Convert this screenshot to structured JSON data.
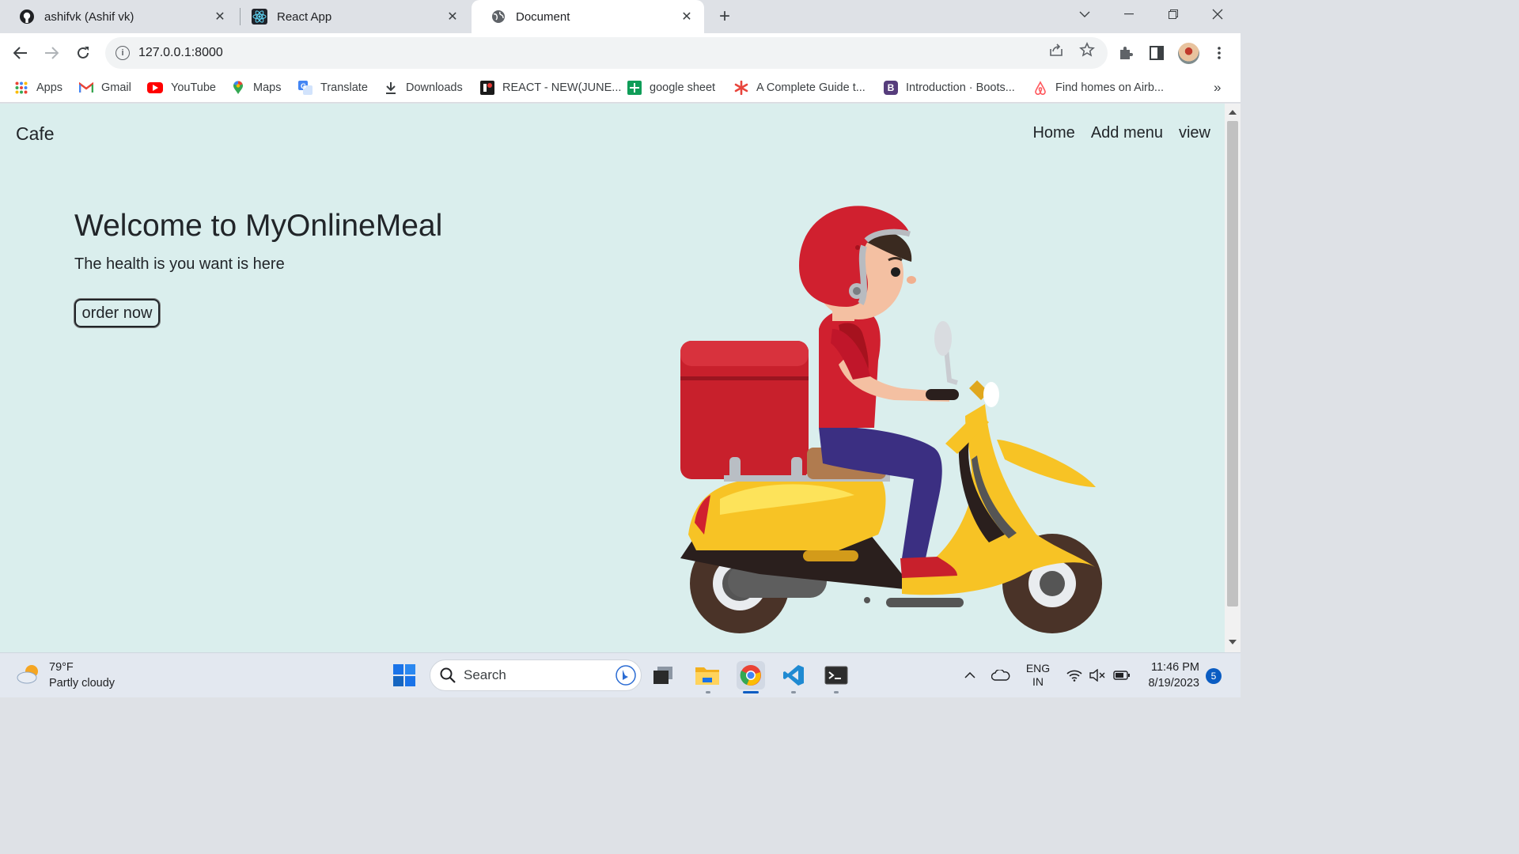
{
  "browser": {
    "tabs": [
      {
        "title": "ashifvk (Ashif vk)",
        "icon": "github-icon"
      },
      {
        "title": "React App",
        "icon": "react-icon"
      },
      {
        "title": "Document",
        "icon": "globe-icon"
      }
    ],
    "url": "127.0.0.1:8000",
    "bookmarks": [
      {
        "label": "Apps",
        "icon": "apps-grid-icon"
      },
      {
        "label": "Gmail",
        "icon": "gmail-icon"
      },
      {
        "label": "YouTube",
        "icon": "youtube-icon"
      },
      {
        "label": "Maps",
        "icon": "maps-icon"
      },
      {
        "label": "Translate",
        "icon": "translate-icon"
      },
      {
        "label": "Downloads",
        "icon": "download-icon"
      },
      {
        "label": "REACT - NEW(JUNE...",
        "icon": "bookmark-icon"
      },
      {
        "label": "google sheet",
        "icon": "sheets-icon"
      },
      {
        "label": "A Complete Guide t...",
        "icon": "asterisk-icon"
      },
      {
        "label": "Introduction · Boots...",
        "icon": "bootstrap-icon"
      },
      {
        "label": "Find homes on Airb...",
        "icon": "airbnb-icon"
      }
    ],
    "bookmarks_overflow": "»"
  },
  "site": {
    "brand": "Cafe",
    "nav": [
      "Home",
      "Add menu",
      "view"
    ],
    "hero_title": "Welcome to MyOnlineMeal",
    "hero_subtitle": "The health is you want is here",
    "cta_label": "order now"
  },
  "taskbar": {
    "weather_temp": "79°F",
    "weather_desc": "Partly cloudy",
    "search_label": "Search",
    "lang_line1": "ENG",
    "lang_line2": "IN",
    "time": "11:46 PM",
    "date": "8/19/2023",
    "notifications": "5"
  },
  "colors": {
    "page_bg": "#daeeed",
    "text": "#212529",
    "helmet_red": "#d0202f",
    "scooter_yellow": "#f7c325"
  }
}
